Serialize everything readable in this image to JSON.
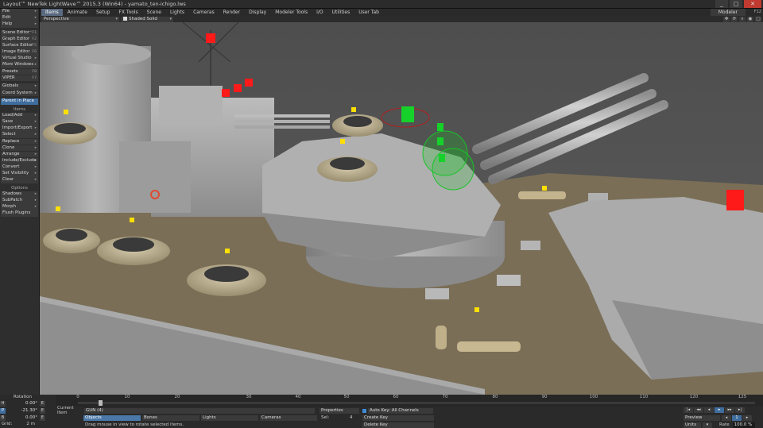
{
  "window": {
    "title": "Layout™ NewTek LightWave™ 2015.3 (Win64) - yamato_ten-ichigo.lws",
    "controls": [
      "_",
      "□",
      "✕"
    ]
  },
  "tabs": [
    "Items",
    "Animate",
    "Setup",
    "FX Tools",
    "Scene",
    "Lights",
    "Cameras",
    "Render",
    "Display",
    "Modeler Tools",
    "I/O",
    "Utilities",
    "User Tab"
  ],
  "modeler": {
    "label": "Modeler",
    "key": "F12"
  },
  "sidebar": {
    "top": [
      {
        "label": "File",
        "sc": "▸"
      },
      {
        "label": "Edit",
        "sc": "▸"
      },
      {
        "label": "Help",
        "sc": "▸"
      }
    ],
    "tools": [
      {
        "label": "Scene Editor",
        "sc": "^F1"
      },
      {
        "label": "Graph Editor",
        "sc": "F2"
      },
      {
        "label": "Surface Editor",
        "sc": "F5"
      },
      {
        "label": "Image Editor",
        "sc": "F6"
      },
      {
        "label": "Virtual Studio",
        "sc": "▸"
      },
      {
        "label": "More Windows",
        "sc": "▸"
      },
      {
        "label": "Presets",
        "sc": "F8"
      },
      {
        "label": "VIPER",
        "sc": "F7"
      }
    ],
    "globals": [
      {
        "label": "Globals",
        "sc": "▸"
      },
      {
        "label": "Coord System",
        "sc": "▸"
      }
    ],
    "parent": "Parent in Place",
    "items_header": "Items",
    "items": [
      {
        "label": "Load/Add",
        "sc": "▸"
      },
      {
        "label": "Save",
        "sc": "▸"
      },
      {
        "label": "Import/Export",
        "sc": "▸"
      },
      {
        "label": "Select",
        "sc": "▸"
      },
      {
        "label": "Replace",
        "sc": "▸"
      },
      {
        "label": "Clone",
        "sc": "▸"
      },
      {
        "label": "Arrange",
        "sc": "▸"
      },
      {
        "label": "Include/Exclude",
        "sc": "▸"
      },
      {
        "label": "Convert",
        "sc": "▸"
      },
      {
        "label": "Set Visibility",
        "sc": "▸"
      },
      {
        "label": "Clear",
        "sc": "▸"
      }
    ],
    "options_header": "Options",
    "options": [
      {
        "label": "Shadows",
        "sc": "▸"
      },
      {
        "label": "SubPatch",
        "sc": "▸"
      },
      {
        "label": "Morph",
        "sc": "▸"
      },
      {
        "label": "Flush Plugins",
        "sc": ""
      }
    ]
  },
  "viewport": {
    "view_mode": "Perspective",
    "shading": "Shaded Solid"
  },
  "rotation": {
    "label": "Rotation",
    "rows": [
      {
        "axis": "H",
        "value": "0.00°"
      },
      {
        "axis": "P",
        "value": "-21.30°"
      },
      {
        "axis": "B",
        "value": "0.00°"
      }
    ],
    "grid_label": "Grid:",
    "grid_value": "2 m"
  },
  "timeline": {
    "labels": [
      "0",
      "10",
      "20",
      "30",
      "40",
      "50",
      "60",
      "70",
      "80",
      "90",
      "100",
      "110",
      "120",
      "125"
    ],
    "current_frame": "0"
  },
  "controls": {
    "current_item_label": "Current Item",
    "current_item": "GUN (4)",
    "item_types": [
      "Objects",
      "Bones",
      "Lights",
      "Cameras"
    ],
    "status": "Drag mouse in view to rotate selected items.",
    "properties": "Properties",
    "sel_label": "Sel:",
    "sel_count": "4",
    "auto_key": "Auto Key: All Channels",
    "create_key": "Create Key",
    "delete_key": "Delete Key",
    "preview": "Preview",
    "step": "1",
    "units": "Units",
    "rate_label": "Rate",
    "rate_value": "100.0 %"
  },
  "colors": {
    "accent": "#3f6d9e",
    "deck": "#7a6e57",
    "hull": "#9a9a9a",
    "selection_green": "#16d12a",
    "null_red": "#ff1a1a",
    "null_yellow": "#ffe000"
  }
}
